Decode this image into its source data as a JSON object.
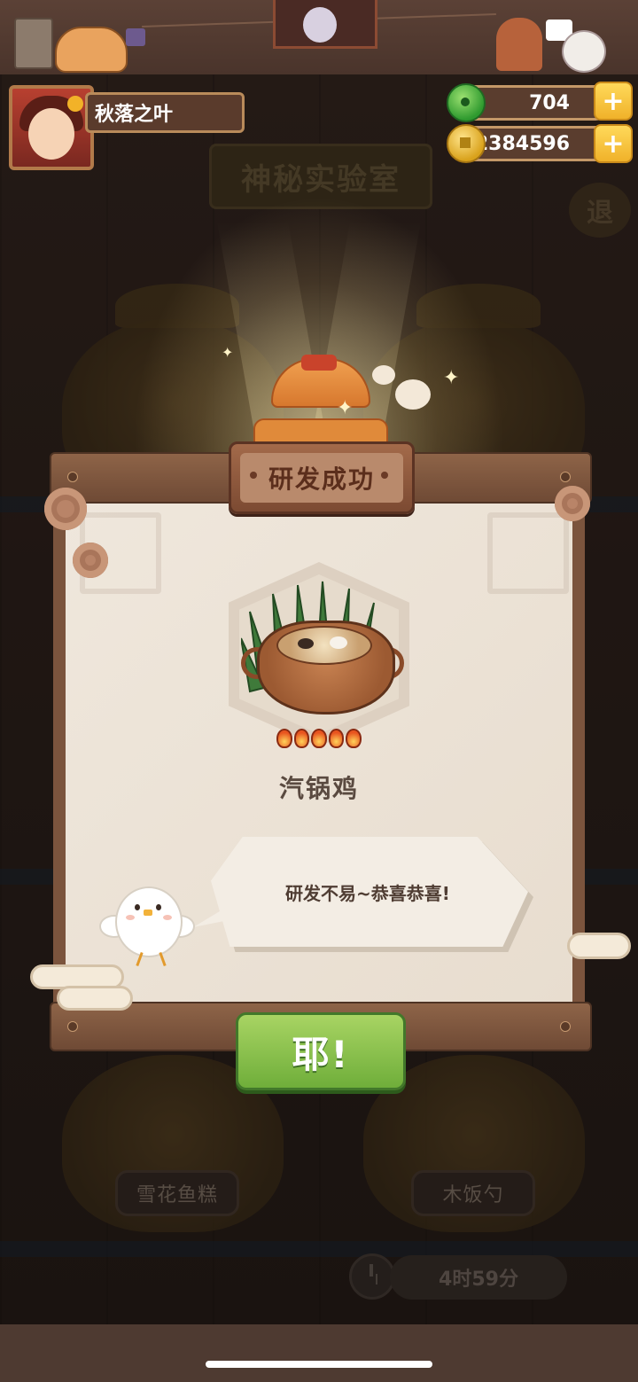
{
  "hud": {
    "player_name": "秋落之叶",
    "jade_count": "704",
    "coin_count": "2384596",
    "plus_label": "+"
  },
  "background": {
    "lab_title": "神秘实验室",
    "exit_label": "退",
    "slot_left_label": "雪花鱼糕",
    "slot_right_label": "木饭勺",
    "timer": "4时59分"
  },
  "popup": {
    "title": "研发成功",
    "dish_name": "汽锅鸡",
    "flame_rating": 5,
    "message": "研发不易~恭喜恭喜!",
    "confirm_label": "耶!"
  },
  "icons": [
    "cat-icon",
    "jade-icon",
    "coin-icon",
    "plus-icon",
    "chick-icon",
    "flame-icon",
    "clock-icon"
  ],
  "colors": {
    "confirm_green": "#7fbe46",
    "popup_paper": "#ece3d7",
    "wood": "#7b543d"
  }
}
